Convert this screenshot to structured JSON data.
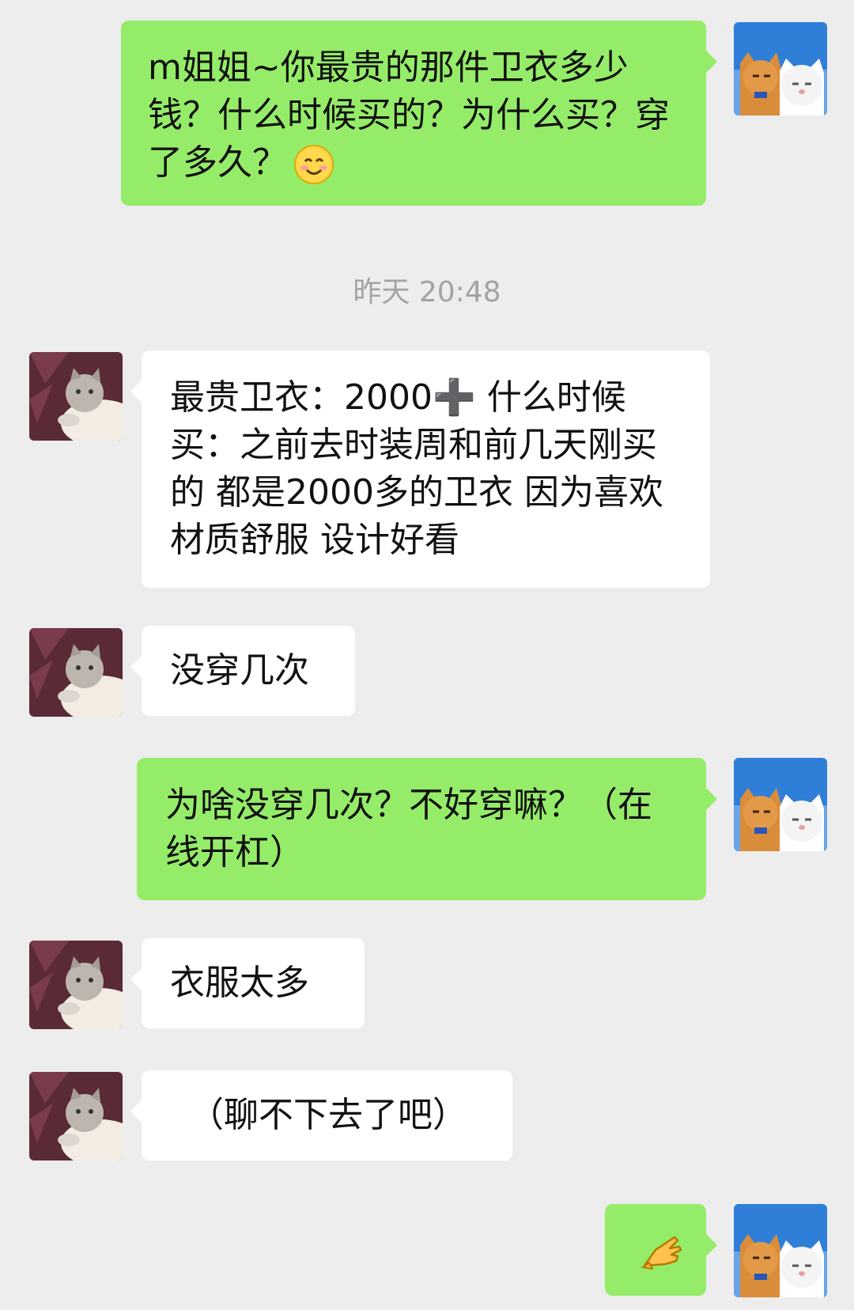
{
  "timestamp": "昨天 20:48",
  "messages": [
    {
      "from": "me",
      "text": "m姐姐~你最贵的那件卫衣多少钱？什么时候买的？为什么买？穿了多久？",
      "emoji": "smiling-face-icon"
    },
    {
      "from": "other",
      "text": "最贵卫衣：2000➕ 什么时候买：之前去时装周和前几天刚买的 都是2000多的卫衣 因为喜欢 材质舒服 设计好看"
    },
    {
      "from": "other",
      "text": "没穿几次"
    },
    {
      "from": "me",
      "text": "为啥没穿几次？不好穿嘛？（在线开杠）"
    },
    {
      "from": "other",
      "text": "衣服太多"
    },
    {
      "from": "other",
      "text": "（聊不下去了吧）"
    },
    {
      "from": "me",
      "text": "",
      "emoji": "pinched-hand-icon"
    }
  ],
  "colors": {
    "background": "#ededed",
    "me_bubble": "#95ec69",
    "other_bubble": "#ffffff",
    "timestamp_text": "#a3a3a3"
  }
}
